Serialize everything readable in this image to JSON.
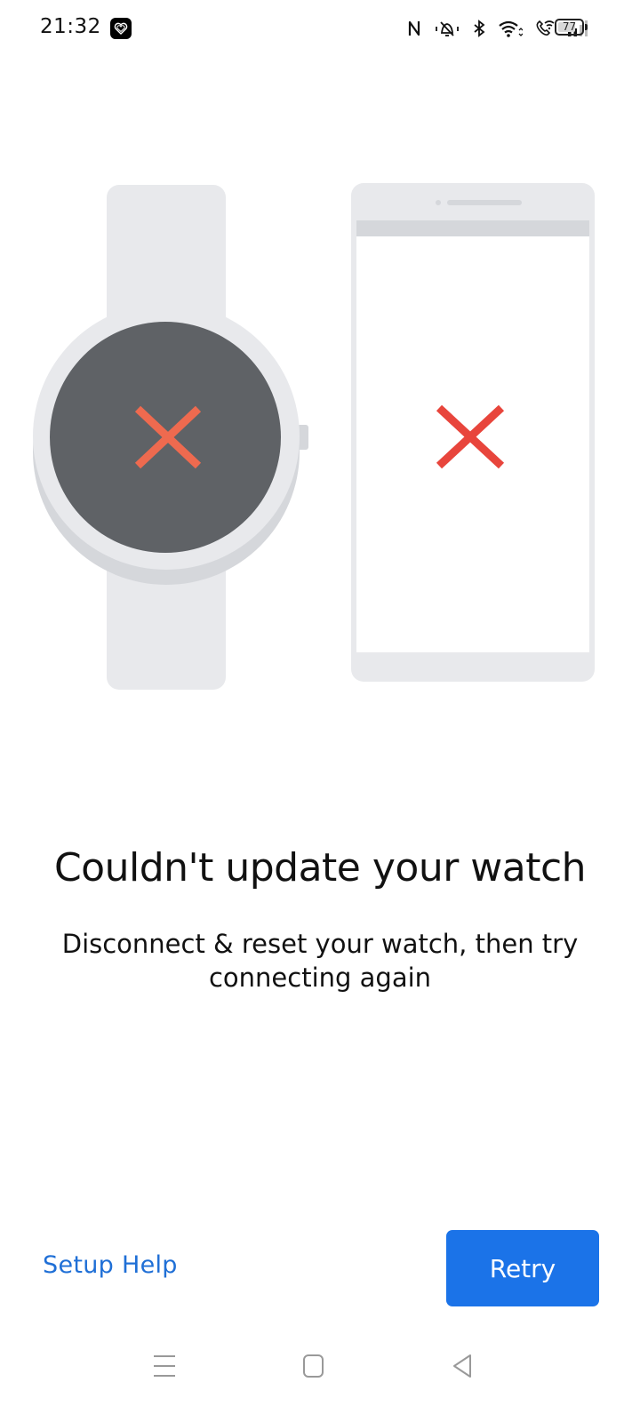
{
  "status_bar": {
    "time": "21:32",
    "notification_icon": "health-heart-icon",
    "icons": [
      "nfc-icon",
      "vibrate-silent-icon",
      "bluetooth-icon",
      "wifi-icon",
      "wifi-calling-icon",
      "signal-icon"
    ],
    "battery_level": "77"
  },
  "illustration": {
    "watch_status": "error-x-icon",
    "phone_status": "error-x-icon",
    "colors": {
      "device_gray": "#e8e9ec",
      "device_shadow": "#d5d7db",
      "watch_face": "#5f6266",
      "watch_x": "#ee6a4f",
      "phone_x": "#e8453c"
    }
  },
  "message": {
    "title": "Couldn't update your watch",
    "body": "Disconnect & reset your watch, then try connecting again"
  },
  "actions": {
    "secondary_label": "Setup Help",
    "primary_label": "Retry",
    "primary_color": "#1b73e8",
    "link_color": "#1f6fd6"
  },
  "nav_bar": {
    "buttons": [
      "recents-icon",
      "home-icon",
      "back-icon"
    ]
  }
}
